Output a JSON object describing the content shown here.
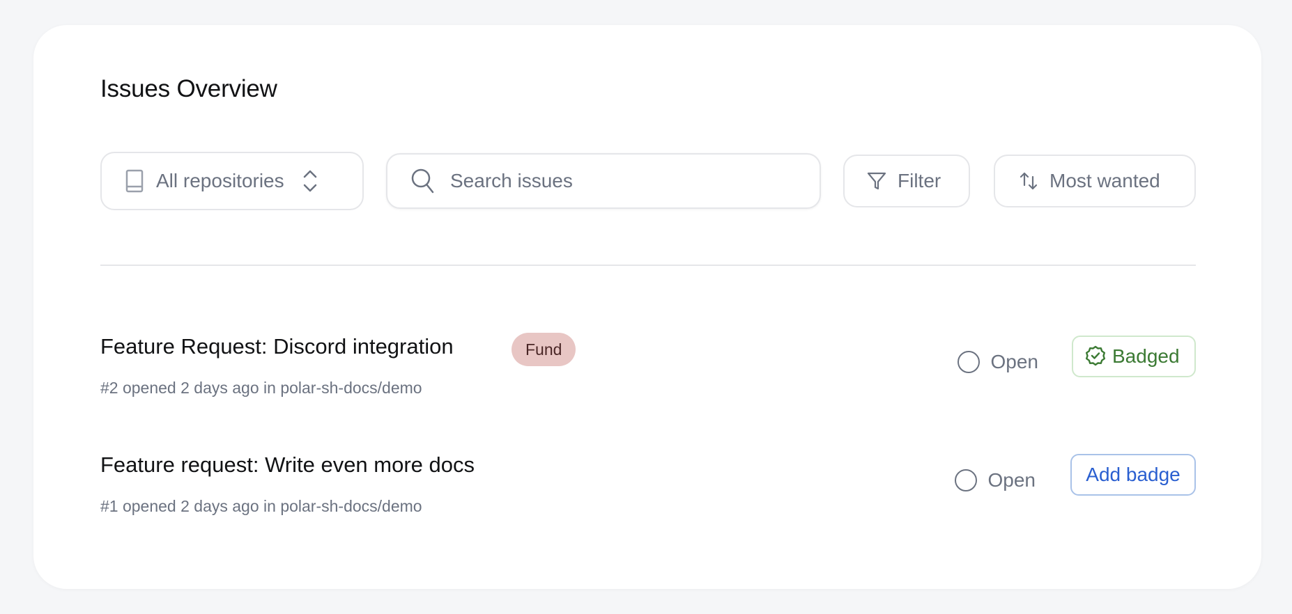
{
  "header": {
    "title": "Issues Overview"
  },
  "toolbar": {
    "repository_select": {
      "value": "All repositories",
      "icon": "book-icon",
      "chevron": "chevron-up-down-icon"
    },
    "search": {
      "placeholder": "Search issues",
      "value": "",
      "icon": "search-icon"
    },
    "filter": {
      "label": "Filter",
      "icon": "funnel-icon"
    },
    "sort": {
      "label": "Most wanted",
      "icon": "arrows-up-down-icon"
    }
  },
  "issues": [
    {
      "title": "Feature Request: Discord integration",
      "pill": "Fund",
      "meta": "#2 opened 2 days ago in polar-sh-docs/demo",
      "status": "Open",
      "badge_action": "Badged",
      "badge_state": "badged"
    },
    {
      "title": "Feature request: Write even more docs",
      "meta": "#1 opened 2 days ago in polar-sh-docs/demo",
      "status": "Open",
      "badge_action": "Add badge",
      "badge_state": "not-badged"
    }
  ],
  "colors": {
    "background": "#f5f6f8",
    "card": "#ffffff",
    "fund_pill": "#e8c6c4",
    "badged_green": "#3b7a33",
    "add_badge_blue": "#2a5fd0",
    "muted_text": "#6b7280"
  }
}
